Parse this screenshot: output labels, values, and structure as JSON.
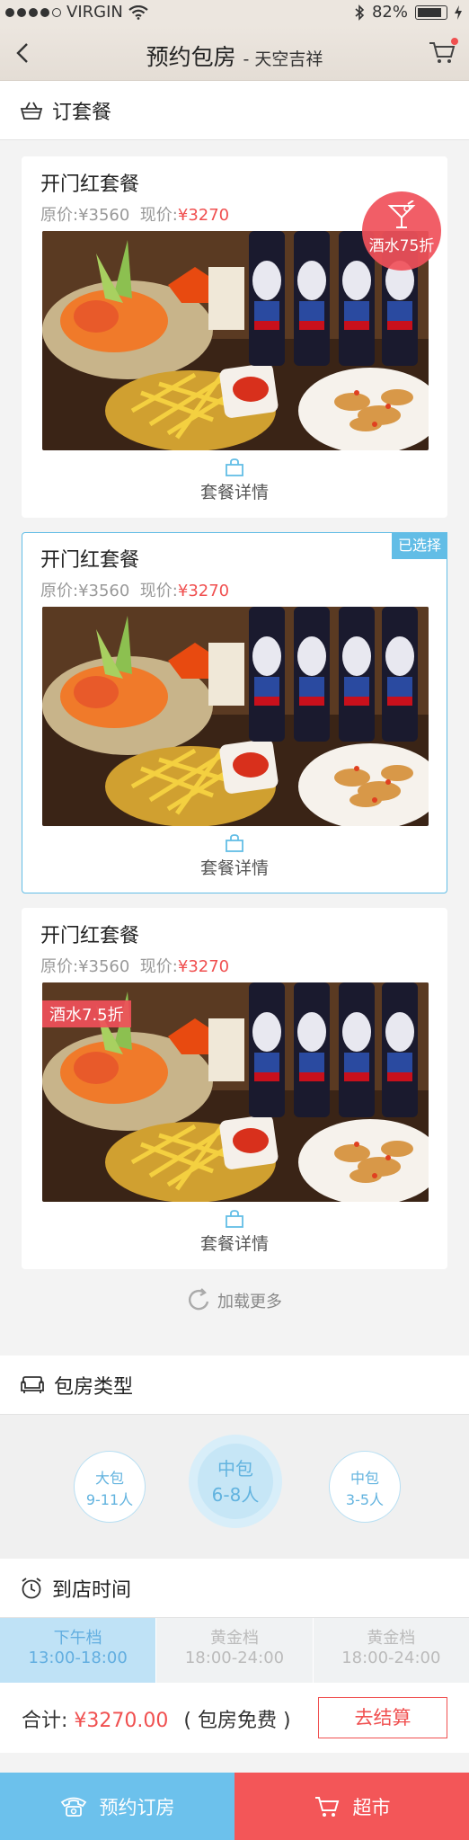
{
  "status_bar": {
    "carrier": "VIRGIN",
    "battery": "82%"
  },
  "header": {
    "title": "预约包房",
    "subtitle": "- 天空吉祥"
  },
  "package_section": {
    "title": "订套餐"
  },
  "packages": [
    {
      "name": "开门红套餐",
      "orig_label": "原价:",
      "orig_price": "¥3560",
      "now_label": "现价:",
      "now_price": "¥3270",
      "detail": "套餐详情",
      "badge": "酒水75折",
      "selected": false
    },
    {
      "name": "开门红套餐",
      "orig_label": "原价:",
      "orig_price": "¥3560",
      "now_label": "现价:",
      "now_price": "¥3270",
      "detail": "套餐详情",
      "tag": "已选择",
      "selected": true
    },
    {
      "name": "开门红套餐",
      "orig_label": "原价:",
      "orig_price": "¥3560",
      "now_label": "现价:",
      "now_price": "¥3270",
      "detail": "套餐详情",
      "badge": "酒水7.5折",
      "selected": false
    }
  ],
  "load_more": "加载更多",
  "room_section": {
    "title": "包房类型"
  },
  "rooms": [
    {
      "size": "大包",
      "people": "9-11人"
    },
    {
      "size": "中包",
      "people": "6-8人"
    },
    {
      "size": "中包",
      "people": "3-5人"
    }
  ],
  "time_section": {
    "title": "到店时间"
  },
  "slots": [
    {
      "name": "下午档",
      "time": "13:00-18:00"
    },
    {
      "name": "黄金档",
      "time": "18:00-24:00"
    },
    {
      "name": "黄金档",
      "time": "18:00-24:00"
    }
  ],
  "summary": {
    "label": "合计:",
    "amount": "¥3270.00",
    "note": "( 包房免费 )",
    "checkout": "去结算"
  },
  "bottom_bar": {
    "book": "预约订房",
    "market": "超市"
  },
  "colors": {
    "accent_blue": "#62bde6",
    "accent_red": "#f05050"
  }
}
